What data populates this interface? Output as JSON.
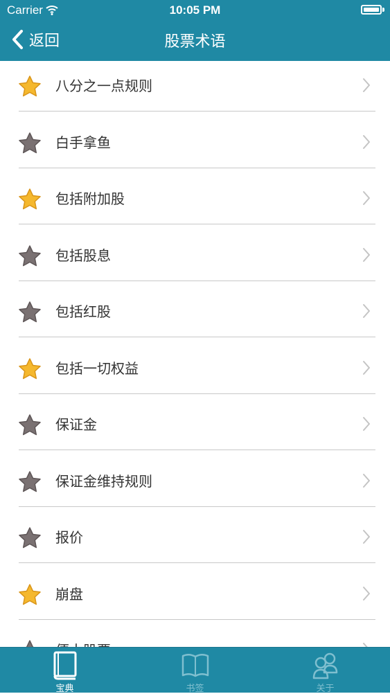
{
  "status_bar": {
    "carrier": "Carrier",
    "time": "10:05 PM"
  },
  "nav": {
    "back_label": "返回",
    "title": "股票术语"
  },
  "terms": [
    {
      "label": "八分之一点规则",
      "starred": true
    },
    {
      "label": "白手拿鱼",
      "starred": false
    },
    {
      "label": "包括附加股",
      "starred": true
    },
    {
      "label": "包括股息",
      "starred": false
    },
    {
      "label": "包括红股",
      "starred": false
    },
    {
      "label": "包括一切权益",
      "starred": true
    },
    {
      "label": "保证金",
      "starred": false
    },
    {
      "label": "保证金维持规则",
      "starred": false
    },
    {
      "label": "报价",
      "starred": false
    },
    {
      "label": "崩盘",
      "starred": true
    },
    {
      "label": "便士股票",
      "starred": false
    }
  ],
  "tabs": [
    {
      "label": "宝典",
      "icon": "book-icon",
      "active": true
    },
    {
      "label": "书签",
      "icon": "open-book-icon",
      "active": false
    },
    {
      "label": "关于",
      "icon": "people-icon",
      "active": false
    }
  ],
  "colors": {
    "header": "#1f89a4",
    "star_gold": "#f5b82e",
    "star_gray": "#7a7172",
    "text": "#333333",
    "separator": "#c8c8c8"
  }
}
